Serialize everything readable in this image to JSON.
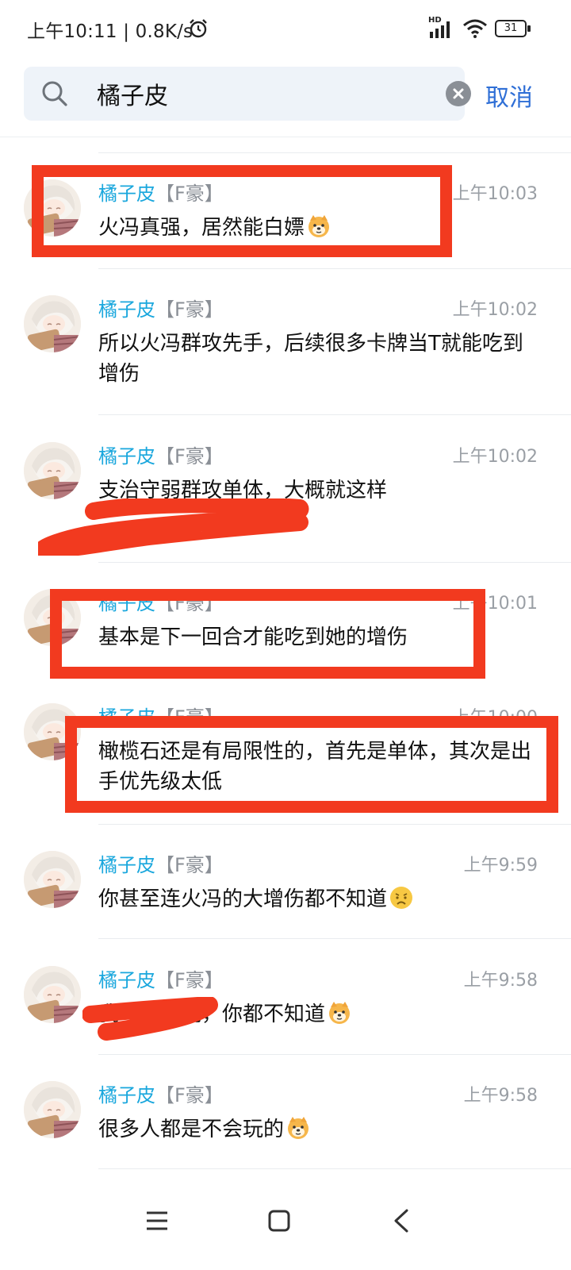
{
  "status_bar": {
    "time_speed": "上午10:11 | 0.8K/s",
    "network": "HD",
    "battery": "31"
  },
  "search": {
    "query": "橘子皮",
    "cancel_label": "取消"
  },
  "messages": [
    {
      "name": "橘子皮",
      "tag": "【F豪】",
      "time": "上午10:03",
      "text": "火冯真强，居然能白嫖",
      "emoji": "doge"
    },
    {
      "name": "橘子皮",
      "tag": "【F豪】",
      "time": "上午10:02",
      "text": "所以火冯群攻先手，后续很多卡牌当T就能吃到增伤",
      "emoji": ""
    },
    {
      "name": "橘子皮",
      "tag": "【F豪】",
      "time": "上午10:02",
      "text": "支治守弱群攻单体，大概就这样",
      "emoji": ""
    },
    {
      "name": "橘子皮",
      "tag": "【F豪】",
      "time": "上午10:01",
      "text": "基本是下一回合才能吃到她的增伤",
      "emoji": ""
    },
    {
      "name": "橘子皮",
      "tag": "【F豪】",
      "time": "上午10:00",
      "text": "橄榄石还是有局限性的，首先是单体，其次是出手优先级太低",
      "emoji": ""
    },
    {
      "name": "橘子皮",
      "tag": "【F豪】",
      "time": "上午9:59",
      "text": "你甚至连火冯的大增伤都不知道",
      "emoji": "sad"
    },
    {
      "name": "橘子皮",
      "tag": "【F豪】",
      "time": "上午9:58",
      "text": "我今天不说，你都不知道",
      "emoji": "doge"
    },
    {
      "name": "橘子皮",
      "tag": "【F豪】",
      "time": "上午9:58",
      "text": "很多人都是不会玩的",
      "emoji": "doge"
    }
  ],
  "colors": {
    "accent": "#2f6fd6",
    "name": "#1aa7dd",
    "annotation_red": "#f23a1f"
  }
}
